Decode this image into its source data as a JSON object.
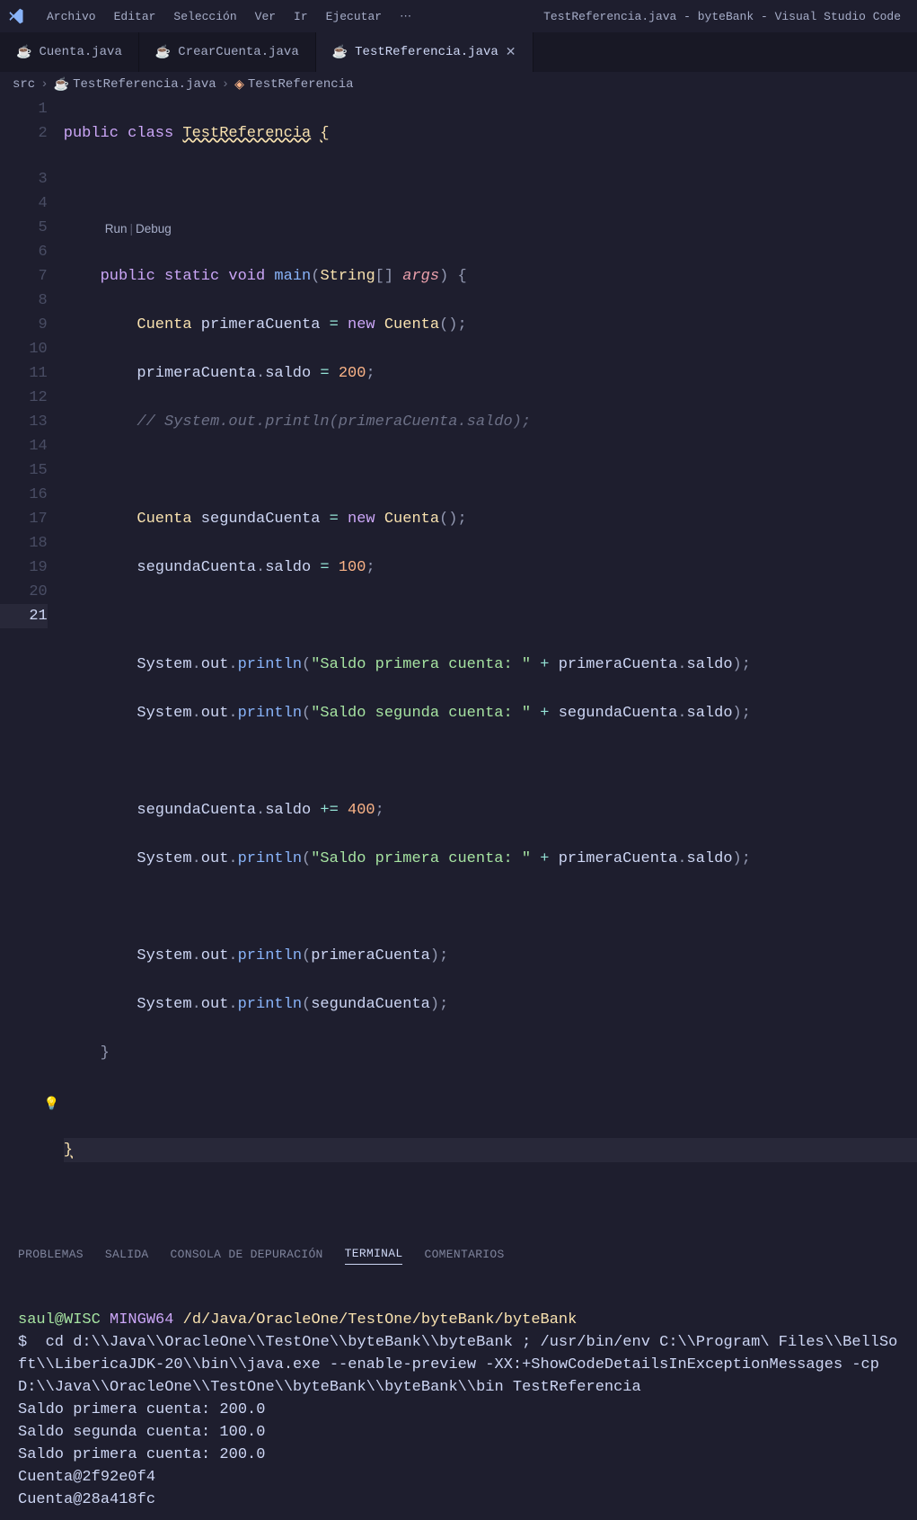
{
  "window_title": "TestReferencia.java - byteBank - Visual Studio Code",
  "menubar": [
    "Archivo",
    "Editar",
    "Selección",
    "Ver",
    "Ir",
    "Ejecutar"
  ],
  "menubar_overflow": "⋯",
  "tabs": [
    {
      "label": "Cuenta.java",
      "active": false
    },
    {
      "label": "CrearCuenta.java",
      "active": false
    },
    {
      "label": "TestReferencia.java",
      "active": true
    }
  ],
  "breadcrumb": [
    {
      "label": "src",
      "icon": null
    },
    {
      "label": "TestReferencia.java",
      "icon": "java"
    },
    {
      "label": "TestReferencia",
      "icon": "symbol-class"
    }
  ],
  "codelens": {
    "run": "Run",
    "debug": "Debug",
    "sep": "|"
  },
  "lines": [
    "1",
    "2",
    "3",
    "4",
    "5",
    "6",
    "7",
    "8",
    "9",
    "10",
    "11",
    "12",
    "13",
    "14",
    "15",
    "16",
    "17",
    "18",
    "19",
    "20",
    "21"
  ],
  "active_line": "21",
  "bulb_line": "20",
  "code": {
    "l1": {
      "kw1": "public",
      "kw2": "class",
      "type": "TestReferencia",
      "br": "{"
    },
    "l3": {
      "kw1": "public",
      "kw2": "static",
      "kw3": "void",
      "fn": "main",
      "p1": "(",
      "ty": "String",
      "arr": "[]",
      "arg": "args",
      "p2": ")",
      "br": "{"
    },
    "l4": {
      "ty": "Cuenta",
      "id": "primeraCuenta",
      "eq": "=",
      "kw": "new",
      "ctor": "Cuenta",
      "call": "()",
      "semi": ";"
    },
    "l5": {
      "id": "primeraCuenta",
      "dot1": ".",
      "prop": "saldo",
      "eq": "=",
      "num": "200",
      "semi": ";"
    },
    "l6": {
      "cmt": "// System.out.println(primeraCuenta.saldo);"
    },
    "l8": {
      "ty": "Cuenta",
      "id": "segundaCuenta",
      "eq": "=",
      "kw": "new",
      "ctor": "Cuenta",
      "call": "()",
      "semi": ";"
    },
    "l9": {
      "id": "segundaCuenta",
      "dot1": ".",
      "prop": "saldo",
      "eq": "=",
      "num": "100",
      "semi": ";"
    },
    "l11": {
      "obj": "System",
      "d1": ".",
      "out": "out",
      "d2": ".",
      "fn": "println",
      "p1": "(",
      "str": "\"Saldo primera cuenta: \"",
      "plus": "+",
      "id": "primeraCuenta",
      "d3": ".",
      "prop": "saldo",
      "p2": ")",
      "semi": ";"
    },
    "l12": {
      "obj": "System",
      "d1": ".",
      "out": "out",
      "d2": ".",
      "fn": "println",
      "p1": "(",
      "str": "\"Saldo segunda cuenta: \"",
      "plus": "+",
      "id": "segundaCuenta",
      "d3": ".",
      "prop": "saldo",
      "p2": ")",
      "semi": ";"
    },
    "l14": {
      "id": "segundaCuenta",
      "d1": ".",
      "prop": "saldo",
      "op": "+=",
      "num": "400",
      "semi": ";"
    },
    "l15": {
      "obj": "System",
      "d1": ".",
      "out": "out",
      "d2": ".",
      "fn": "println",
      "p1": "(",
      "str": "\"Saldo primera cuenta: \"",
      "plus": "+",
      "id": "primeraCuenta",
      "d3": ".",
      "prop2": "saldo",
      "p2": ")",
      "semi": ";"
    },
    "l17": {
      "obj": "System",
      "d1": ".",
      "out": "out",
      "d2": ".",
      "fn": "println",
      "p1": "(",
      "id": "primeraCuenta",
      "p2": ")",
      "semi": ";"
    },
    "l18": {
      "obj": "System",
      "d1": ".",
      "out": "out",
      "d2": ".",
      "fn": "println",
      "p1": "(",
      "id": "segundaCuenta",
      "p2": ")",
      "semi": ";"
    },
    "l19": {
      "br": "}"
    },
    "l21": {
      "br": "}"
    }
  },
  "panel_tabs": [
    "PROBLEMAS",
    "SALIDA",
    "CONSOLA DE DEPURACIÓN",
    "TERMINAL",
    "COMENTARIOS"
  ],
  "panel_active": "TERMINAL",
  "terminal": {
    "user": "saul@WISC",
    "ming": "MINGW64",
    "cwd": "/d/Java/OracleOne/TestOne/byteBank/byteBank",
    "prompt": "$",
    "cmd": "  cd d:\\\\Java\\\\OracleOne\\\\TestOne\\\\byteBank\\\\byteBank ; /usr/bin/env C:\\\\Program\\ Files\\\\BellSoft\\\\LibericaJDK-20\\\\bin\\\\java.exe --enable-preview -XX:+ShowCodeDetailsInExceptionMessages -cp D:\\\\Java\\\\OracleOne\\\\TestOne\\\\byteBank\\\\byteBank\\\\bin TestReferencia",
    "out": [
      "Saldo primera cuenta: 200.0",
      "Saldo segunda cuenta: 100.0",
      "Saldo primera cuenta: 200.0",
      "Cuenta@2f92e0f4",
      "Cuenta@28a418fc"
    ]
  }
}
